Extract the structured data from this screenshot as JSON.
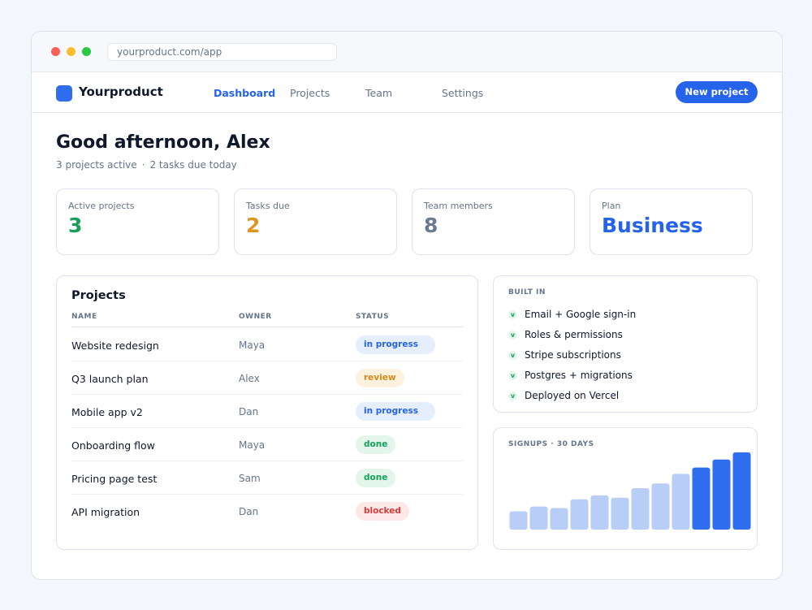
{
  "browser": {
    "url": "yourproduct.com/app"
  },
  "app": {
    "name": "Yourproduct",
    "brand_color": "#2563eb"
  },
  "nav": {
    "items": [
      {
        "label": "Dashboard",
        "active": true
      },
      {
        "label": "Projects",
        "active": false
      },
      {
        "label": "Team",
        "active": false
      },
      {
        "label": "Settings",
        "active": false
      }
    ],
    "cta_label": "New project"
  },
  "header": {
    "greeting": "Good afternoon, Alex",
    "active_summary": "3 projects active",
    "separator": "·",
    "due_summary": "2 tasks due today"
  },
  "stats": [
    {
      "label": "Active projects",
      "value": "3",
      "color": "#16a05a"
    },
    {
      "label": "Tasks due",
      "value": "2",
      "color": "#e0961f"
    },
    {
      "label": "Team members",
      "value": "8",
      "color": "#6b7a90"
    },
    {
      "label": "Plan",
      "value": "Business",
      "color": "#2563eb"
    }
  ],
  "projects": {
    "title": "Projects",
    "columns": [
      "NAME",
      "OWNER",
      "STATUS"
    ],
    "rows": [
      {
        "name": "Website redesign",
        "owner": "Maya",
        "status": "in progress",
        "status_key": "in_progress"
      },
      {
        "name": "Q3 launch plan",
        "owner": "Alex",
        "status": "review",
        "status_key": "review"
      },
      {
        "name": "Mobile app v2",
        "owner": "Dan",
        "status": "in progress",
        "status_key": "in_progress"
      },
      {
        "name": "Onboarding flow",
        "owner": "Maya",
        "status": "done",
        "status_key": "done"
      },
      {
        "name": "Pricing page test",
        "owner": "Sam",
        "status": "done",
        "status_key": "done"
      },
      {
        "name": "API migration",
        "owner": "Dan",
        "status": "blocked",
        "status_key": "blocked"
      }
    ]
  },
  "built_in": {
    "title": "BUILT IN",
    "check_icon": "check-icon",
    "check_glyph": "v",
    "items": [
      "Email + Google sign-in",
      "Roles & permissions",
      "Stripe subscriptions",
      "Postgres + migrations",
      "Deployed on Vercel"
    ]
  },
  "signups": {
    "title": "SIGNUPS · 30 DAYS"
  },
  "chart_data": {
    "type": "bar",
    "title": "SIGNUPS · 30 DAYS",
    "values": [
      23,
      29,
      27,
      38,
      43,
      40,
      52,
      58,
      70,
      78,
      88,
      97
    ],
    "highlight_from_index": 9,
    "colors": {
      "base": "#b8cef6",
      "highlight": "#2f6fef"
    },
    "ylim": [
      0,
      100
    ],
    "grid": false,
    "xlabel": "",
    "ylabel": ""
  }
}
